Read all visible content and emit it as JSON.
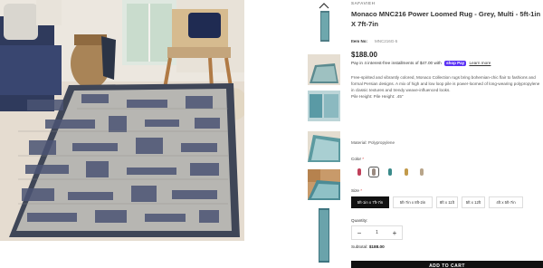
{
  "product": {
    "brand": "SAFAVIEH",
    "title": "Monaco MNC216 Power Loomed Rug - Grey, Multi - 5ft-1in X 7ft-7in",
    "sku_label": "Item No:",
    "sku_value": "MNC216G-5",
    "price": "$188.00",
    "installments": {
      "text": "Pay in 4 interest-free installments of $47.00 with",
      "brand": "shop Pay",
      "link": "Learn more"
    },
    "description": [
      "Free-spirited and vibrantly colored, Monaco Collection rugs bring bohemian-chic flair to fashions and formal Persian designs. A mix of high and low loop pile is power-loomed of long-wearing polypropylene in classic textures and trendy weave-influenced looks.",
      "Pile Height: Pile Height: .45\""
    ],
    "material": "Material: Polypropylene"
  },
  "color": {
    "label": "Color",
    "required": "*",
    "swatches": [
      {
        "name": "pink-multi",
        "color": "#c0405a"
      },
      {
        "name": "grey-multi",
        "color": "#9a8a80"
      },
      {
        "name": "teal-multi",
        "color": "#3a8a8a"
      },
      {
        "name": "gold-multi",
        "color": "#c29a4a"
      },
      {
        "name": "beige-multi",
        "color": "#b8a58a"
      }
    ],
    "selected": 1
  },
  "size": {
    "label": "Size",
    "required": "*",
    "options": [
      "5ft-1in x 7ft-7in",
      "5ft-7in x 8ft-2in",
      "8ft x 11ft",
      "5ft x 12ft",
      "4ft x 5ft-7in"
    ],
    "selected": 0
  },
  "quantity": {
    "label": "Quantity:",
    "value": "1",
    "minus": "−",
    "plus": "+"
  },
  "subtotal": {
    "label": "Subtotal:",
    "value": "$188.00"
  },
  "cart": {
    "button": "ADD TO CART"
  },
  "thumbnails": {
    "up_icon": "chevron-up-icon",
    "count": 7
  }
}
